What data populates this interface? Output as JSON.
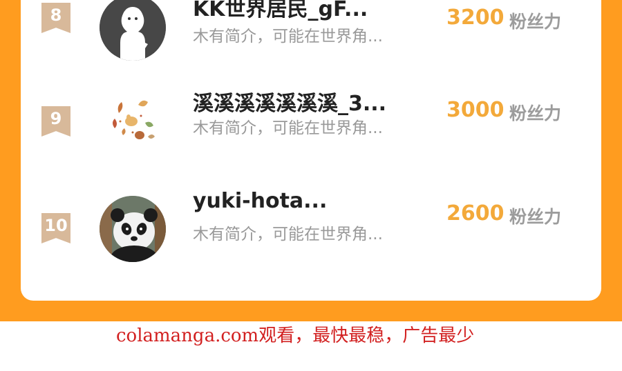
{
  "leaderboard": {
    "rows": [
      {
        "rank": "8",
        "name": "KK世界居民_gF...",
        "bio": "木有简介，可能在世界角...",
        "score": "3200",
        "score_unit": "粉丝力",
        "avatar_icon": "ghost-figure-avatar"
      },
      {
        "rank": "9",
        "name": "溪溪溪溪溪溪溪_3...",
        "bio": "木有简介，可能在世界角...",
        "score": "3000",
        "score_unit": "粉丝力",
        "avatar_icon": "autumn-leaves-avatar"
      },
      {
        "rank": "10",
        "name": "yuki-hota...",
        "bio": "木有简介，可能在世界角...",
        "score": "2600",
        "score_unit": "粉丝力",
        "avatar_icon": "panda-photo-avatar"
      }
    ]
  },
  "footer": {
    "watermark": "colamanga.com观看，最快最稳，广告最少"
  },
  "colors": {
    "frame": "#ff9c1f",
    "score": "#f3a93a",
    "badge": "#d8b99a",
    "watermark": "#d22020"
  }
}
